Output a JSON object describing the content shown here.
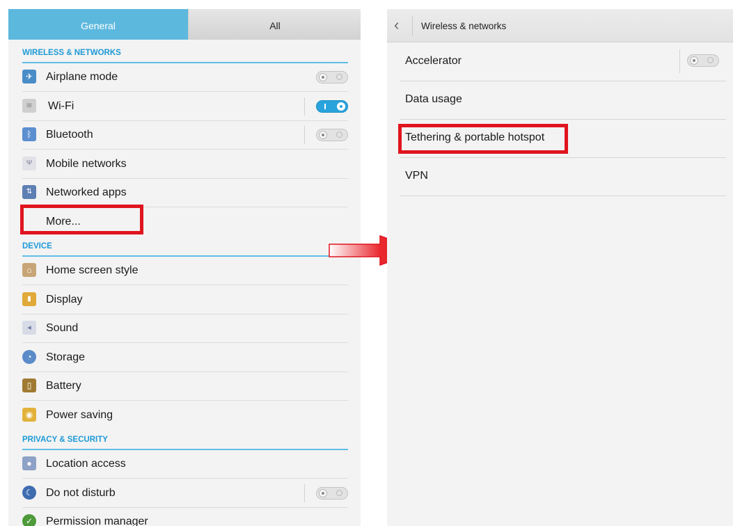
{
  "left": {
    "tabs": {
      "general": "General",
      "all": "All"
    },
    "sections": {
      "wireless": "WIRELESS & NETWORKS",
      "device": "DEVICE",
      "privacy": "PRIVACY & SECURITY"
    },
    "wireless_items": [
      {
        "label": "Airplane mode",
        "icon": "airplane-icon",
        "toggle": "off"
      },
      {
        "label": "Wi-Fi",
        "icon": "wifi-icon",
        "toggle": "on"
      },
      {
        "label": "Bluetooth",
        "icon": "bluetooth-icon",
        "toggle": "off"
      },
      {
        "label": "Mobile networks",
        "icon": "antenna-icon"
      },
      {
        "label": "Networked apps",
        "icon": "network-apps-icon"
      },
      {
        "label": "More..."
      }
    ],
    "device_items": [
      {
        "label": "Home screen style",
        "icon": "home-icon"
      },
      {
        "label": "Display",
        "icon": "display-icon"
      },
      {
        "label": "Sound",
        "icon": "speaker-icon"
      },
      {
        "label": "Storage",
        "icon": "storage-icon"
      },
      {
        "label": "Battery",
        "icon": "battery-icon"
      },
      {
        "label": "Power saving",
        "icon": "lightbulb-icon"
      }
    ],
    "privacy_items": [
      {
        "label": "Location access",
        "icon": "location-icon"
      },
      {
        "label": "Do not disturb",
        "icon": "moon-icon",
        "toggle": "off"
      },
      {
        "label": "Permission manager",
        "icon": "permission-icon"
      }
    ]
  },
  "right": {
    "title": "Wireless & networks",
    "items": [
      {
        "label": "Accelerator",
        "toggle": "off"
      },
      {
        "label": "Data usage"
      },
      {
        "label": "Tethering & portable hotspot"
      },
      {
        "label": "VPN"
      }
    ]
  },
  "colors": {
    "accent": "#1e9ad6",
    "highlight": "#e0141e",
    "tab_active": "#5db8de"
  }
}
